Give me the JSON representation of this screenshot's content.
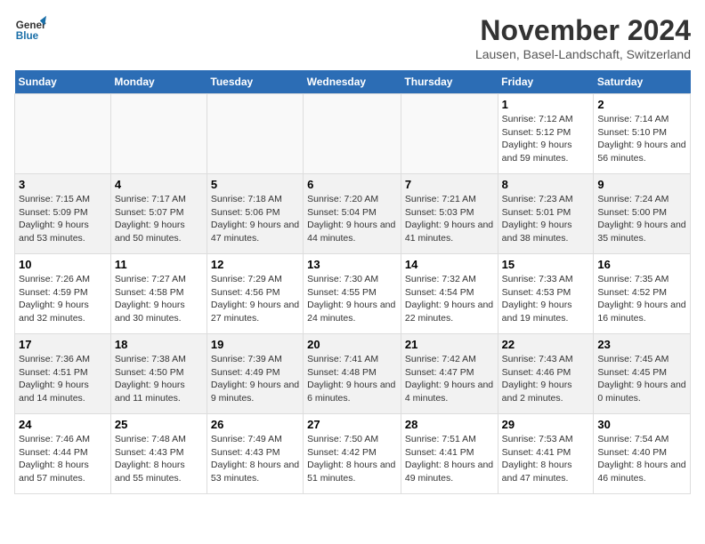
{
  "logo": {
    "line1": "General",
    "line2": "Blue"
  },
  "title": "November 2024",
  "location": "Lausen, Basel-Landschaft, Switzerland",
  "weekdays": [
    "Sunday",
    "Monday",
    "Tuesday",
    "Wednesday",
    "Thursday",
    "Friday",
    "Saturday"
  ],
  "weeks": [
    [
      {
        "day": "",
        "info": ""
      },
      {
        "day": "",
        "info": ""
      },
      {
        "day": "",
        "info": ""
      },
      {
        "day": "",
        "info": ""
      },
      {
        "day": "",
        "info": ""
      },
      {
        "day": "1",
        "info": "Sunrise: 7:12 AM\nSunset: 5:12 PM\nDaylight: 9 hours and 59 minutes."
      },
      {
        "day": "2",
        "info": "Sunrise: 7:14 AM\nSunset: 5:10 PM\nDaylight: 9 hours and 56 minutes."
      }
    ],
    [
      {
        "day": "3",
        "info": "Sunrise: 7:15 AM\nSunset: 5:09 PM\nDaylight: 9 hours and 53 minutes."
      },
      {
        "day": "4",
        "info": "Sunrise: 7:17 AM\nSunset: 5:07 PM\nDaylight: 9 hours and 50 minutes."
      },
      {
        "day": "5",
        "info": "Sunrise: 7:18 AM\nSunset: 5:06 PM\nDaylight: 9 hours and 47 minutes."
      },
      {
        "day": "6",
        "info": "Sunrise: 7:20 AM\nSunset: 5:04 PM\nDaylight: 9 hours and 44 minutes."
      },
      {
        "day": "7",
        "info": "Sunrise: 7:21 AM\nSunset: 5:03 PM\nDaylight: 9 hours and 41 minutes."
      },
      {
        "day": "8",
        "info": "Sunrise: 7:23 AM\nSunset: 5:01 PM\nDaylight: 9 hours and 38 minutes."
      },
      {
        "day": "9",
        "info": "Sunrise: 7:24 AM\nSunset: 5:00 PM\nDaylight: 9 hours and 35 minutes."
      }
    ],
    [
      {
        "day": "10",
        "info": "Sunrise: 7:26 AM\nSunset: 4:59 PM\nDaylight: 9 hours and 32 minutes."
      },
      {
        "day": "11",
        "info": "Sunrise: 7:27 AM\nSunset: 4:58 PM\nDaylight: 9 hours and 30 minutes."
      },
      {
        "day": "12",
        "info": "Sunrise: 7:29 AM\nSunset: 4:56 PM\nDaylight: 9 hours and 27 minutes."
      },
      {
        "day": "13",
        "info": "Sunrise: 7:30 AM\nSunset: 4:55 PM\nDaylight: 9 hours and 24 minutes."
      },
      {
        "day": "14",
        "info": "Sunrise: 7:32 AM\nSunset: 4:54 PM\nDaylight: 9 hours and 22 minutes."
      },
      {
        "day": "15",
        "info": "Sunrise: 7:33 AM\nSunset: 4:53 PM\nDaylight: 9 hours and 19 minutes."
      },
      {
        "day": "16",
        "info": "Sunrise: 7:35 AM\nSunset: 4:52 PM\nDaylight: 9 hours and 16 minutes."
      }
    ],
    [
      {
        "day": "17",
        "info": "Sunrise: 7:36 AM\nSunset: 4:51 PM\nDaylight: 9 hours and 14 minutes."
      },
      {
        "day": "18",
        "info": "Sunrise: 7:38 AM\nSunset: 4:50 PM\nDaylight: 9 hours and 11 minutes."
      },
      {
        "day": "19",
        "info": "Sunrise: 7:39 AM\nSunset: 4:49 PM\nDaylight: 9 hours and 9 minutes."
      },
      {
        "day": "20",
        "info": "Sunrise: 7:41 AM\nSunset: 4:48 PM\nDaylight: 9 hours and 6 minutes."
      },
      {
        "day": "21",
        "info": "Sunrise: 7:42 AM\nSunset: 4:47 PM\nDaylight: 9 hours and 4 minutes."
      },
      {
        "day": "22",
        "info": "Sunrise: 7:43 AM\nSunset: 4:46 PM\nDaylight: 9 hours and 2 minutes."
      },
      {
        "day": "23",
        "info": "Sunrise: 7:45 AM\nSunset: 4:45 PM\nDaylight: 9 hours and 0 minutes."
      }
    ],
    [
      {
        "day": "24",
        "info": "Sunrise: 7:46 AM\nSunset: 4:44 PM\nDaylight: 8 hours and 57 minutes."
      },
      {
        "day": "25",
        "info": "Sunrise: 7:48 AM\nSunset: 4:43 PM\nDaylight: 8 hours and 55 minutes."
      },
      {
        "day": "26",
        "info": "Sunrise: 7:49 AM\nSunset: 4:43 PM\nDaylight: 8 hours and 53 minutes."
      },
      {
        "day": "27",
        "info": "Sunrise: 7:50 AM\nSunset: 4:42 PM\nDaylight: 8 hours and 51 minutes."
      },
      {
        "day": "28",
        "info": "Sunrise: 7:51 AM\nSunset: 4:41 PM\nDaylight: 8 hours and 49 minutes."
      },
      {
        "day": "29",
        "info": "Sunrise: 7:53 AM\nSunset: 4:41 PM\nDaylight: 8 hours and 47 minutes."
      },
      {
        "day": "30",
        "info": "Sunrise: 7:54 AM\nSunset: 4:40 PM\nDaylight: 8 hours and 46 minutes."
      }
    ]
  ]
}
